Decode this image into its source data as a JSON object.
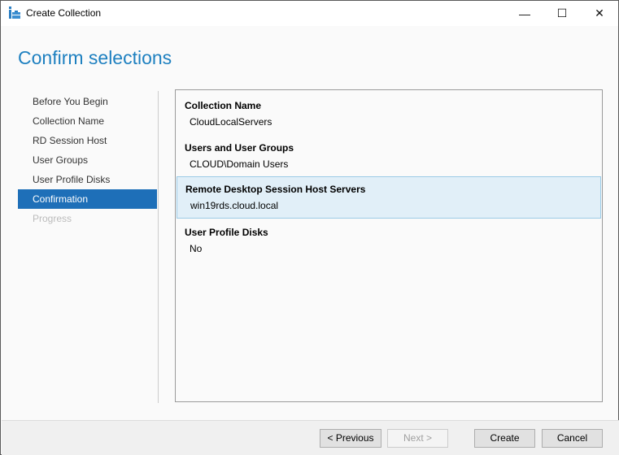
{
  "window": {
    "title": "Create Collection",
    "minimize": "—",
    "maximize": "☐",
    "close": "✕"
  },
  "page_title": "Confirm selections",
  "nav": [
    {
      "label": "Before You Begin",
      "state": "normal"
    },
    {
      "label": "Collection Name",
      "state": "normal"
    },
    {
      "label": "RD Session Host",
      "state": "normal"
    },
    {
      "label": "User Groups",
      "state": "normal"
    },
    {
      "label": "User Profile Disks",
      "state": "normal"
    },
    {
      "label": "Confirmation",
      "state": "active"
    },
    {
      "label": "Progress",
      "state": "disabled"
    }
  ],
  "sections": [
    {
      "heading": "Collection Name",
      "value": "CloudLocalServers"
    },
    {
      "heading": "Users and User Groups",
      "value": "CLOUD\\Domain Users"
    },
    {
      "heading": "Remote Desktop Session Host Servers",
      "value": "win19rds.cloud.local"
    },
    {
      "heading": "User Profile Disks",
      "value": "No"
    }
  ],
  "buttons": {
    "previous": "< Previous",
    "next": "Next >",
    "create": "Create",
    "cancel": "Cancel"
  }
}
